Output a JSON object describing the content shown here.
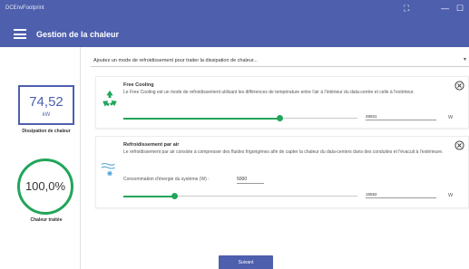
{
  "window": {
    "app_title": "DCEnvFootprint",
    "controls": {
      "fullscreen": "⛶",
      "minimize": "—",
      "maximize": "☐"
    }
  },
  "header": {
    "title": "Gestion de la chaleur",
    "menu_icon": "hamburger-menu-icon"
  },
  "sidebar": {
    "dissipation": {
      "value": "74,52",
      "unit": "kW",
      "label": "Dissipation de chaleur"
    },
    "treated": {
      "value": "100,0%",
      "label": "Chaleur traitée",
      "percent": 100
    }
  },
  "dropdown": {
    "placeholder": "Ajoutez un mode de refroidissement pour traiter la dissipation de chaleur...",
    "caret_icon": "caret-down-icon"
  },
  "cooling_modes": [
    {
      "title": "Free Cooling",
      "description": "Le Free Cooling est un mode de refroidissement utilisant les différences de température entre l'air à l'intérieur du data-centre et celle à l'extérieur.",
      "icon": "recycle-icon",
      "slider_fraction": 0.67,
      "value": "49931",
      "unit": "W"
    },
    {
      "title": "Refroidissement par air",
      "description": "Le refroidissement par air consiste à compresser des fluides frigorigènes afin de capter la chaleur du data-centers dans des conduites et l'évacuit à l'extérieure.",
      "icon": "air-cooling-icon",
      "consumption_label": "Consommation d'énergie du système (W) :",
      "consumption_value": "5000",
      "slider_fraction": 0.22,
      "value": "15592",
      "unit": "W"
    }
  ],
  "colors": {
    "primary": "#4e5fad",
    "accent": "#22a55a"
  },
  "actions": {
    "next_label": "Suivant"
  }
}
